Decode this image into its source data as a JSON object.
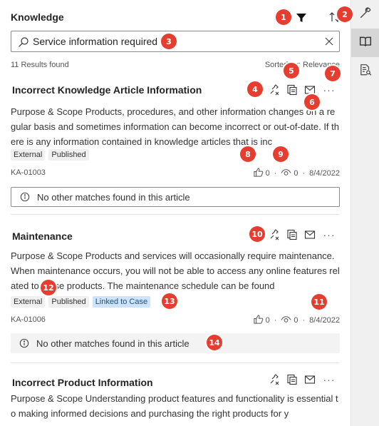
{
  "header": {
    "title": "Knowledge"
  },
  "search": {
    "value": "Service information required"
  },
  "results": {
    "count_text": "11 Results found",
    "sorted_text": "Sorted by: Relevance"
  },
  "articles": [
    {
      "title": "Incorrect Knowledge Article Information",
      "body": "Purpose & Scope Products, procedures, and other information changes on a regular basis and sometimes information can become incorrect or out-of-date. If there is any information contained in knowledge articles that is inc",
      "tags": [
        "External",
        "Published"
      ],
      "id": "KA-01003",
      "likes": "0",
      "views": "0",
      "date": "8/4/2022",
      "no_match": "No other matches found in this article"
    },
    {
      "title": "Maintenance",
      "body": "Purpose & Scope Products and services will occasionally require maintenance. When maintenance occurs, you will not be able to access any online features related to these products. The maintenance schedule can be found",
      "tags": [
        "External",
        "Published",
        "Linked to Case"
      ],
      "id": "KA-01006",
      "likes": "0",
      "views": "0",
      "date": "8/4/2022",
      "no_match": "No other matches found in this article"
    },
    {
      "title": "Incorrect Product Information",
      "body": "Purpose & Scope Understanding product features and functionality is essential to making informed decisions and purchasing the right products for y"
    }
  ],
  "actions": {
    "more": "···"
  },
  "badges": [
    "1",
    "2",
    "3",
    "4",
    "5",
    "6",
    "7",
    "8",
    "9",
    "10",
    "11",
    "12",
    "13",
    "14"
  ],
  "colors": {
    "badge": "#e53d2f",
    "linked_tag_bg": "#cfe4fa",
    "rail_bg": "#f0f0f0"
  },
  "icons": [
    "filter-icon",
    "sort-icon",
    "search-icon",
    "clear-icon",
    "wrench-icon",
    "book-icon",
    "document-search-icon",
    "link-icon",
    "copy-icon",
    "email-icon",
    "thumbs-up-icon",
    "eye-icon",
    "info-icon"
  ]
}
